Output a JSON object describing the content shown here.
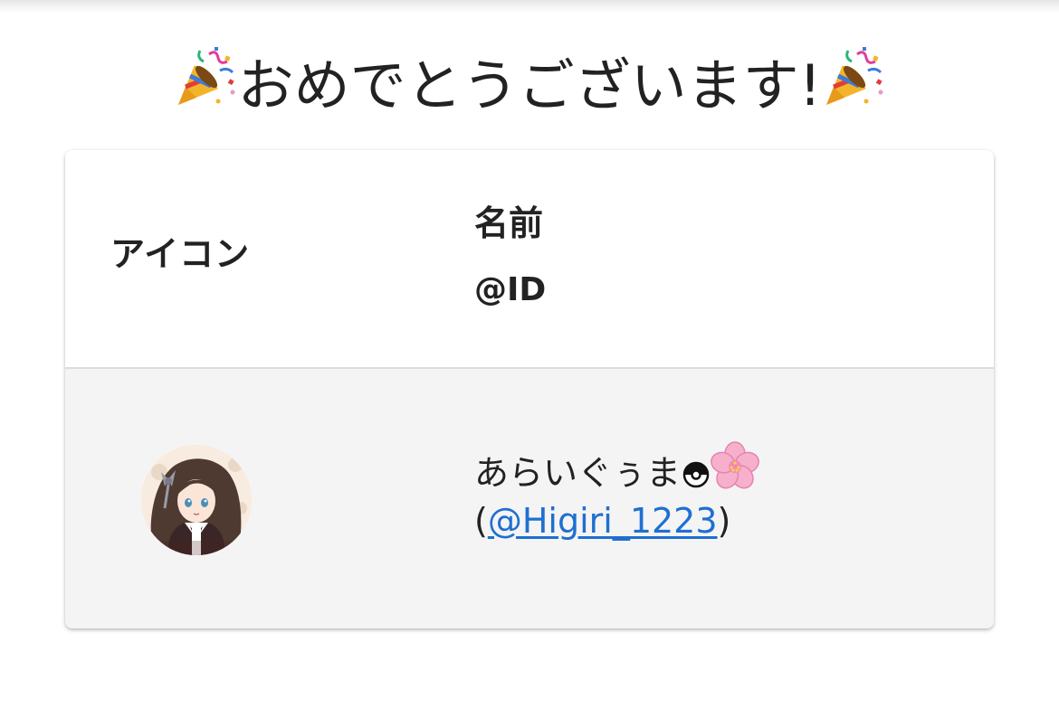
{
  "title": {
    "text": "おめでとうございます!",
    "left_icon": "party-popper-icon",
    "right_icon": "party-popper-icon"
  },
  "table": {
    "headers": {
      "icon": "アイコン",
      "name": "名前",
      "id": "@ID"
    },
    "rows": [
      {
        "avatar": "user-avatar",
        "name": "あらいぐぅま",
        "name_icons": [
          "pokeball-icon",
          "cherry-blossom-icon"
        ],
        "id_prefix": "(",
        "id": "@Higiri_1223",
        "id_suffix": ")"
      }
    ]
  },
  "colors": {
    "link": "#1f6fd0",
    "row_background": "#f4f4f4",
    "text": "#222222"
  }
}
